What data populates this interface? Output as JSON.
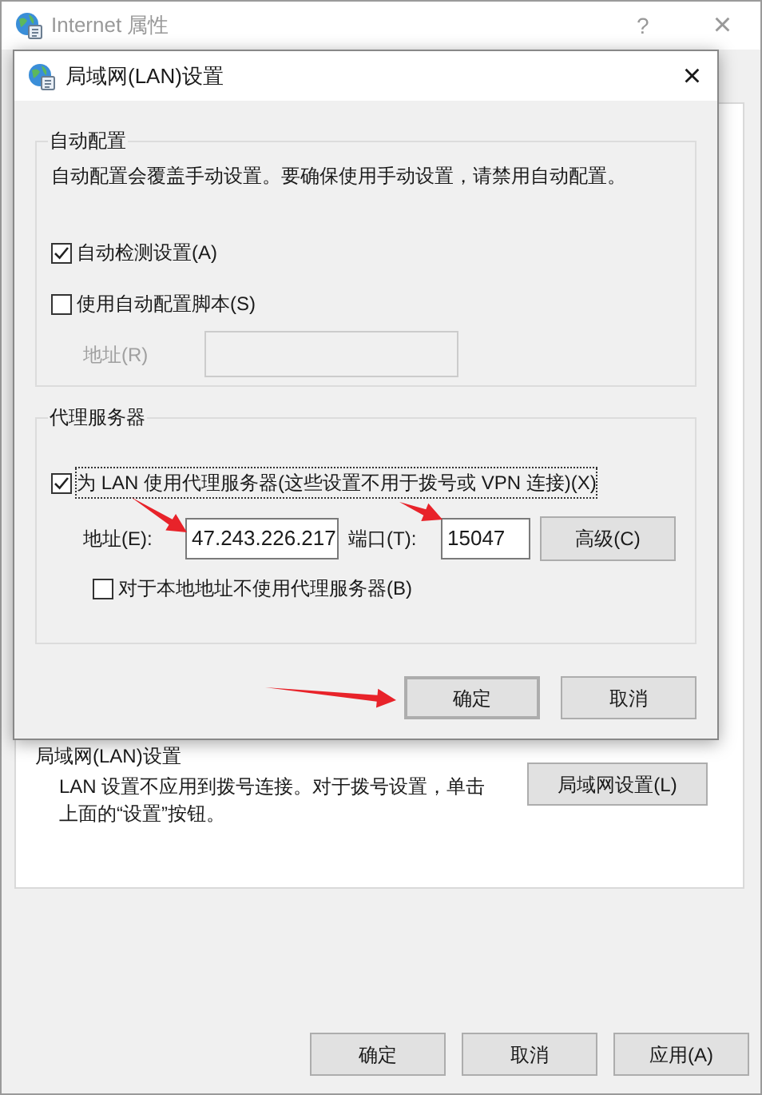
{
  "window": {
    "title": "Internet 属性",
    "help": "?",
    "close": "×"
  },
  "back_section": {
    "heading": "局域网(LAN)设置",
    "description": "LAN 设置不应用到拨号连接。对于拨号设置，单击上面的“设置”按钮。",
    "button": "局域网设置(L)"
  },
  "footer_buttons": [
    "确定",
    "取消",
    "应用(A)"
  ],
  "dialog": {
    "title": "局域网(LAN)设置",
    "close": "×",
    "auto_config": {
      "legend": "自动配置",
      "description": "自动配置会覆盖手动设置。要确保使用手动设置，请禁用自动配置。",
      "options": [
        {
          "label": "自动检测设置(A)",
          "checked": true
        },
        {
          "label": "使用自动配置脚本(S)",
          "checked": false
        }
      ],
      "address": {
        "label": "地址(R)",
        "disabled": true
      }
    },
    "proxy": {
      "legend": "代理服务器",
      "use_proxy": {
        "label": "为 LAN 使用代理服务器(这些设置不用于拨号或 VPN 连接)(X)",
        "checked": true
      },
      "address_label": "地址(E):",
      "address": "47.243.226.217",
      "port_label": "端口(T):",
      "port": "15047",
      "advanced": "高级(C)",
      "bypass": {
        "label": "对于本地地址不使用代理服务器(B)",
        "checked": false
      }
    },
    "buttons": [
      {
        "label": "确定",
        "default": true
      },
      {
        "label": "取消",
        "default": false
      }
    ]
  }
}
